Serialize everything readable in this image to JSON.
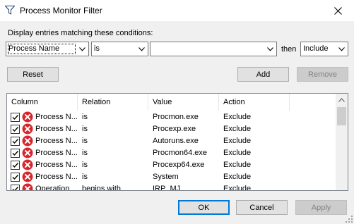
{
  "window": {
    "title": "Process Monitor Filter",
    "close_glyph": "✕"
  },
  "conditions": {
    "label": "Display entries matching these conditions:",
    "column": "Process Name",
    "relation": "is",
    "value": "",
    "then": "then",
    "action": "Include"
  },
  "buttons": {
    "reset": "Reset",
    "add": "Add",
    "remove": "Remove",
    "ok": "OK",
    "cancel": "Cancel",
    "apply": "Apply"
  },
  "table": {
    "headers": [
      "Column",
      "Relation",
      "Value",
      "Action"
    ],
    "rows": [
      {
        "checked": true,
        "column": "Process N...",
        "relation": "is",
        "value": "Procmon.exe",
        "action": "Exclude"
      },
      {
        "checked": true,
        "column": "Process N...",
        "relation": "is",
        "value": "Procexp.exe",
        "action": "Exclude"
      },
      {
        "checked": true,
        "column": "Process N...",
        "relation": "is",
        "value": "Autoruns.exe",
        "action": "Exclude"
      },
      {
        "checked": true,
        "column": "Process N...",
        "relation": "is",
        "value": "Procmon64.exe",
        "action": "Exclude"
      },
      {
        "checked": true,
        "column": "Process N...",
        "relation": "is",
        "value": "Procexp64.exe",
        "action": "Exclude"
      },
      {
        "checked": true,
        "column": "Process N...",
        "relation": "is",
        "value": "System",
        "action": "Exclude"
      },
      {
        "checked": true,
        "column": "Operation",
        "relation": "begins with",
        "value": "IRP_MJ_",
        "action": "Exclude"
      }
    ]
  },
  "icons": {
    "row_icon": "red-x-icon",
    "app": "process-monitor-filter-icon"
  },
  "colors": {
    "exclude_icon": "#d9262c",
    "default_button_border": "#0078d7"
  }
}
